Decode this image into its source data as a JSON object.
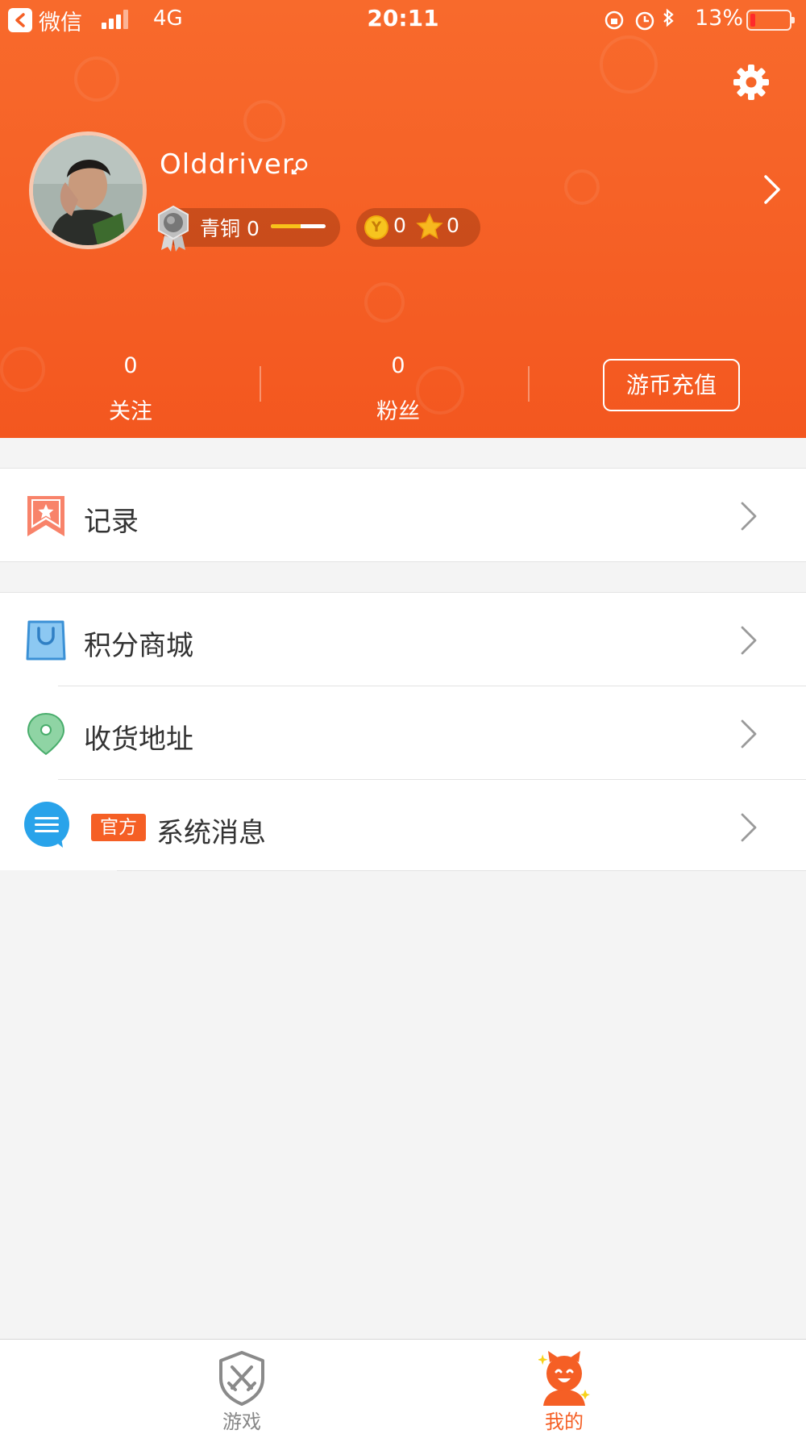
{
  "status_bar": {
    "back_app": "微信",
    "network": "4G",
    "time": "20:11",
    "battery": "13%"
  },
  "profile": {
    "username": "Olddriver",
    "level_name": "青铜",
    "level_value": "0",
    "level_progress": 0.55,
    "coins": "0",
    "stars": "0"
  },
  "stats": {
    "following_count": "0",
    "following_label": "关注",
    "fans_count": "0",
    "fans_label": "粉丝",
    "recharge_label": "游币充值"
  },
  "menu": {
    "records": "记录",
    "points_mall": "积分商城",
    "shipping_address": "收货地址",
    "official_tag": "官方",
    "system_messages": "系统消息"
  },
  "tabbar": {
    "games": "游戏",
    "mine": "我的"
  },
  "colors": {
    "accent": "#f55f25",
    "tab_active": "#f55f25",
    "tab_inactive": "#888888",
    "background": "#f4f4f4"
  },
  "icons": [
    "back-icon",
    "settings-gear-icon",
    "bronze-medal-icon",
    "coin-icon",
    "star-icon",
    "record-bookmark-icon",
    "shopping-bag-icon",
    "location-pin-icon",
    "message-bubble-icon",
    "shield-swords-icon",
    "mascot-icon"
  ]
}
